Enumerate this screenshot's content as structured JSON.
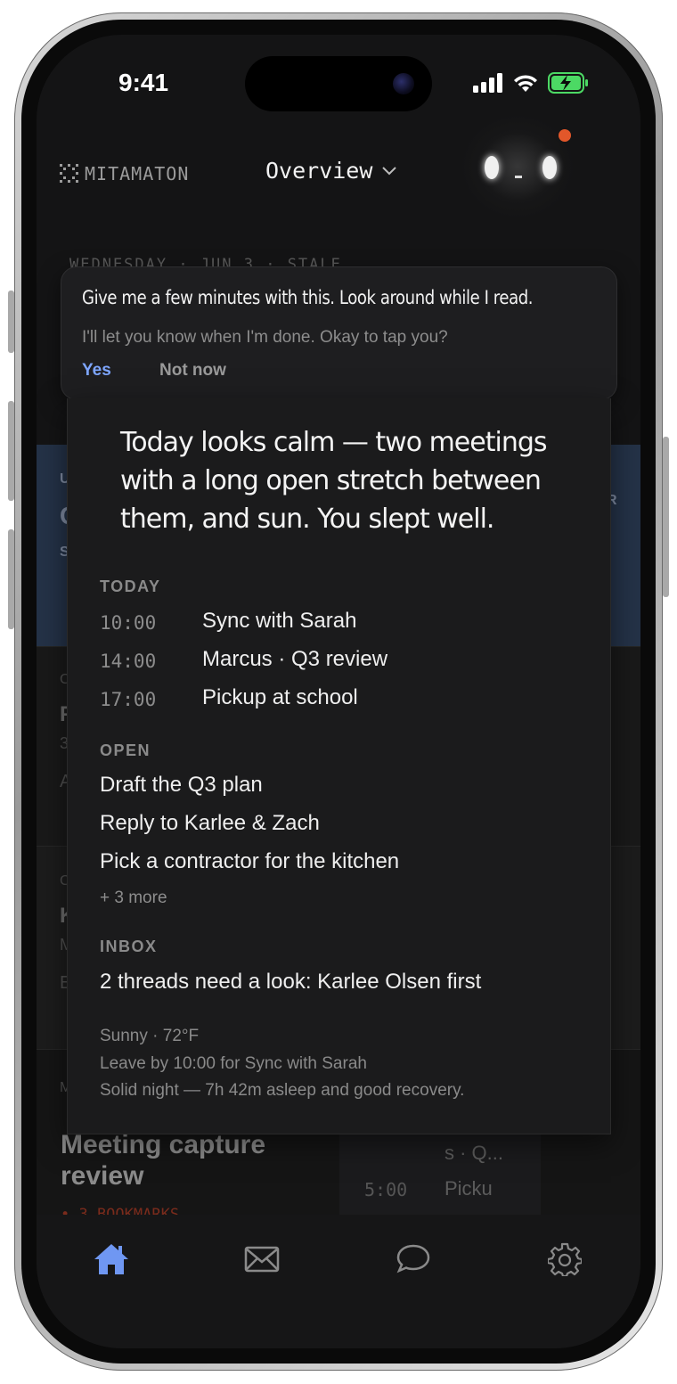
{
  "status_bar": {
    "time": "9:41"
  },
  "header": {
    "logo_text": "MITAMATON",
    "title": "Overview"
  },
  "background": {
    "date_line": "WEDNESDAY · JUN 3 · STALE",
    "meeting_card": {
      "title": "Meeting capture review",
      "bookmarks": "• 3 BOOKMARKS",
      "mini_cal": [
        {
          "time": "",
          "event": "s · Q..."
        },
        {
          "time": "5:00",
          "event": "Picku"
        }
      ]
    }
  },
  "toast": {
    "message": "Give me a few minutes with this. Look around while I read.",
    "subtext": "I'll let you know when I'm done. Okay to tap you?",
    "yes_label": "Yes",
    "not_now_label": "Not now"
  },
  "brief": {
    "summary": "Today looks calm — two meetings with a long open stretch between them, and sun. You slept well.",
    "today_label": "TODAY",
    "events": [
      {
        "time": "10:00",
        "title": "Sync with Sarah"
      },
      {
        "time": "14:00",
        "title": "Marcus · Q3 review"
      },
      {
        "time": "17:00",
        "title": "Pickup at school"
      }
    ],
    "open_label": "OPEN",
    "open_items": [
      "Draft the Q3 plan",
      "Reply to Karlee & Zach",
      "Pick a contractor for the kitchen"
    ],
    "more_label": "+ 3 more",
    "inbox_label": "INBOX",
    "inbox_text": "2 threads need a look: Karlee Olsen first",
    "footnotes": [
      "Sunny · 72°F",
      "Leave by 10:00 for Sync with Sarah",
      "Solid night — 7h 42m asleep and good recovery."
    ]
  },
  "tabbar": {
    "tabs": [
      {
        "icon": "home-icon",
        "active": true
      },
      {
        "icon": "mail-icon",
        "active": false
      },
      {
        "icon": "chat-icon",
        "active": false
      },
      {
        "icon": "gear-icon",
        "active": false
      }
    ],
    "active_color": "#6f97f2"
  }
}
